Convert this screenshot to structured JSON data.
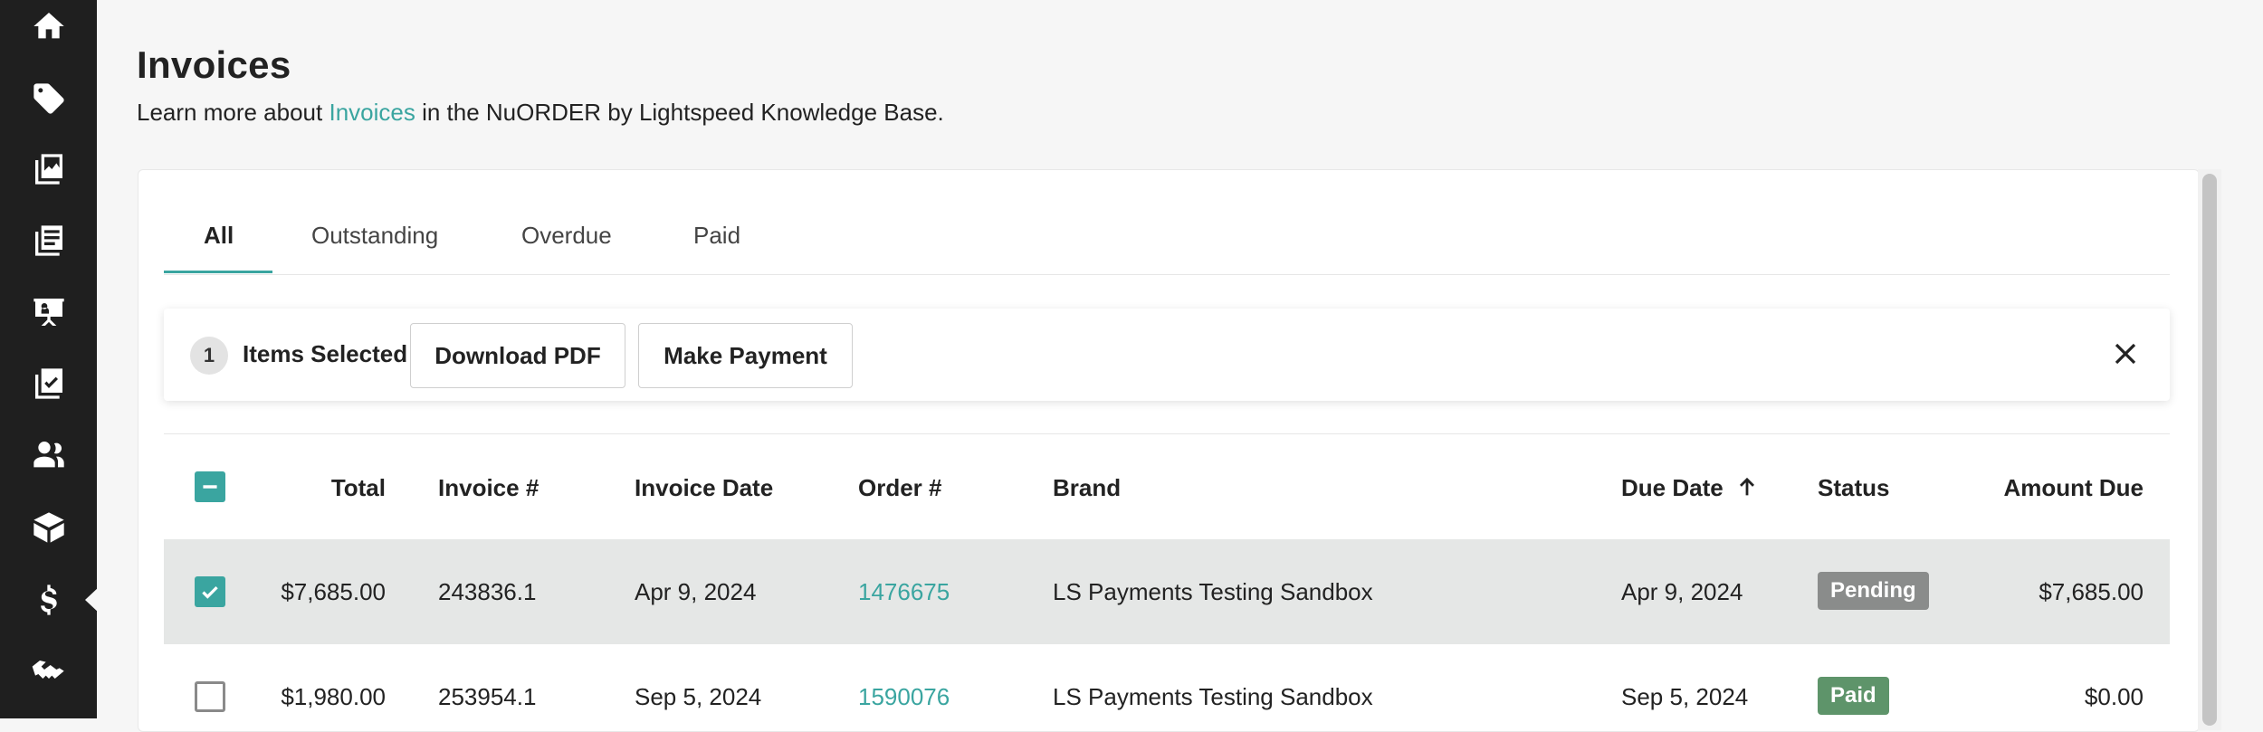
{
  "sidebar": {
    "items": [
      {
        "icon": "home-icon"
      },
      {
        "icon": "tag-icon"
      },
      {
        "icon": "catalog-images-icon"
      },
      {
        "icon": "orders-list-icon"
      },
      {
        "icon": "presentation-icon"
      },
      {
        "icon": "checklist-icon"
      },
      {
        "icon": "users-icon"
      },
      {
        "icon": "box-icon"
      },
      {
        "icon": "dollar-icon",
        "active": true
      },
      {
        "icon": "handshake-icon"
      }
    ]
  },
  "header": {
    "title": "Invoices",
    "subtitle_prefix": "Learn more about ",
    "subtitle_link": "Invoices",
    "subtitle_suffix": " in the NuORDER by Lightspeed Knowledge Base."
  },
  "tabs": [
    {
      "label": "All",
      "active": true
    },
    {
      "label": "Outstanding"
    },
    {
      "label": "Overdue"
    },
    {
      "label": "Paid"
    }
  ],
  "selection_bar": {
    "count": "1",
    "label": "Items Selected",
    "download_label": "Download PDF",
    "payment_label": "Make Payment"
  },
  "table": {
    "headers": {
      "total": "Total",
      "invoice": "Invoice #",
      "invoice_date": "Invoice Date",
      "order": "Order #",
      "brand": "Brand",
      "due_date": "Due Date",
      "status": "Status",
      "amount_due": "Amount Due"
    },
    "sort": {
      "column": "due_date",
      "direction": "ascending",
      "icon": "arrow-up-icon"
    },
    "rows": [
      {
        "selected": true,
        "total": "$7,685.00",
        "invoice": "243836.1",
        "invoice_date": "Apr 9, 2024",
        "order": "1476675",
        "brand": "LS Payments Testing Sandbox",
        "due_date": "Apr 9, 2024",
        "status": "Pending",
        "amount_due": "$7,685.00"
      },
      {
        "selected": false,
        "total": "$1,980.00",
        "invoice": "253954.1",
        "invoice_date": "Sep 5, 2024",
        "order": "1590076",
        "brand": "LS Payments Testing Sandbox",
        "due_date": "Sep 5, 2024",
        "status": "Paid",
        "amount_due": "$0.00"
      }
    ]
  },
  "colors": {
    "accent": "#3aa5a0",
    "sidebar_bg": "#1f1f1f",
    "pending": "#8a8c8b",
    "paid": "#5e946a"
  }
}
